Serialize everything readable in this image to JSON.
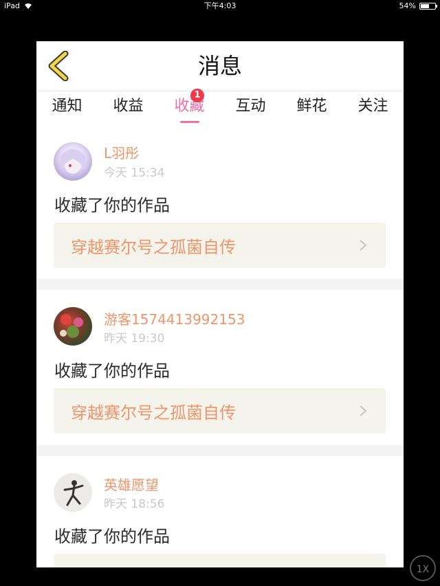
{
  "status_bar": {
    "device": "iPad",
    "time": "下午4:03",
    "battery": "54%",
    "battery_level": 0.54
  },
  "nav": {
    "title": "消息",
    "back_icon": "chevron-left-icon"
  },
  "tabs": [
    {
      "label": "通知"
    },
    {
      "label": "收益"
    },
    {
      "label": "收藏",
      "active": true,
      "badge": "1"
    },
    {
      "label": "互动"
    },
    {
      "label": "鲜花"
    },
    {
      "label": "关注"
    }
  ],
  "colors": {
    "accent": "#f06fa2",
    "name": "#f0956b",
    "badge": "#f3394c",
    "card": "#f4f3ec"
  },
  "messages": [
    {
      "username": "L羽彤",
      "time": "今天 15:34",
      "action": "收藏了你的作品",
      "work_title": "穿越赛尔号之孤菌自传"
    },
    {
      "username": "游客1574413992153",
      "time": "昨天 19:30",
      "action": "收藏了你的作品",
      "work_title": "穿越赛尔号之孤菌自传"
    },
    {
      "username": "英雄愿望",
      "time": "昨天 18:56",
      "action": "收藏了你的作品",
      "work_title": ""
    }
  ],
  "zoom_label": "1X"
}
